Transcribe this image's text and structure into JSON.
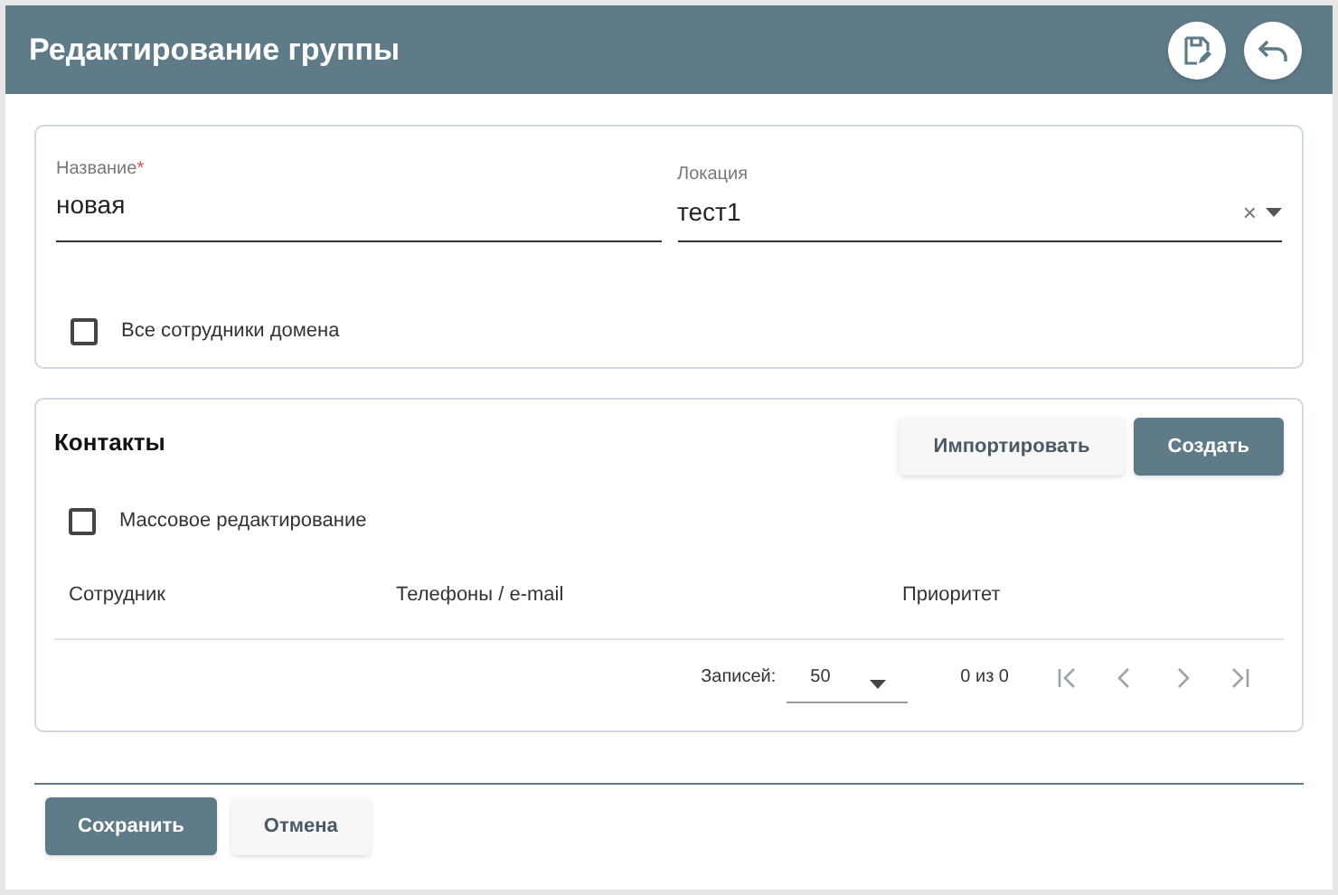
{
  "header": {
    "title": "Редактирование группы",
    "actions": [
      {
        "kind": "save"
      },
      {
        "kind": "back"
      }
    ]
  },
  "form": {
    "name_field": {
      "label": "Название",
      "required_mark": "*",
      "value": "новая"
    },
    "location_field": {
      "label": "Локация",
      "value": "тест1",
      "clear": "×"
    },
    "all_employees": {
      "label": "Все сотрудники домена",
      "checked": false
    }
  },
  "contacts": {
    "title": "Контакты",
    "buttons": [
      {
        "label": "Импортировать",
        "kind": "secondary"
      },
      {
        "label": "Создать",
        "kind": "primary"
      }
    ],
    "bulk_edit": {
      "label": "Массовое редактирование",
      "checked": false
    },
    "columns": [
      "Сотрудник",
      "Телефоны / e-mail",
      "Приоритет"
    ],
    "pagination": {
      "per_page_label": "Записей:",
      "per_page": "50",
      "range": "0 из 0",
      "pager": [
        {
          "kind": "first",
          "disabled": true
        },
        {
          "kind": "prev",
          "disabled": true
        },
        {
          "kind": "next",
          "disabled": true
        },
        {
          "kind": "last",
          "disabled": true
        }
      ]
    }
  },
  "footer": {
    "buttons": [
      {
        "label": "Сохранить",
        "kind": "primary"
      },
      {
        "label": "Отмена",
        "kind": "secondary"
      }
    ]
  }
}
